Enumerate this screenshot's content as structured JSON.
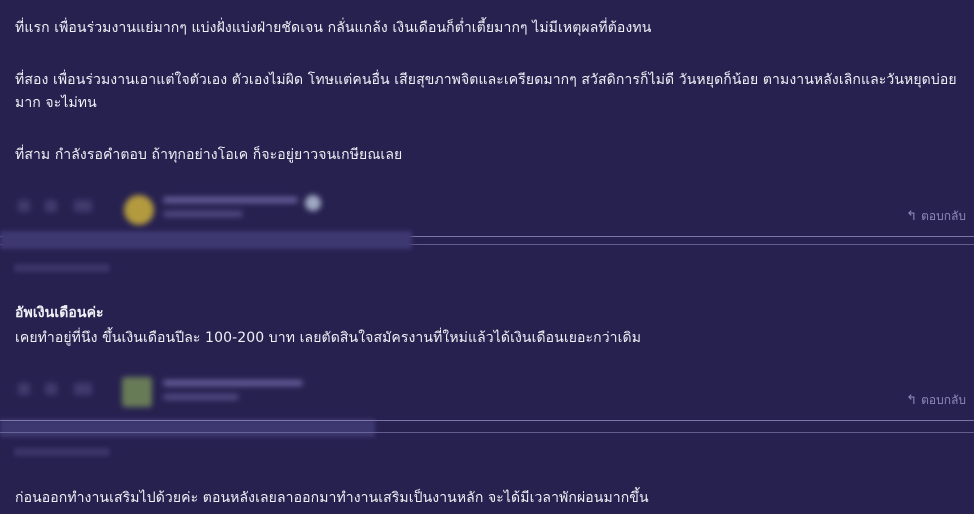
{
  "comments": [
    {
      "paragraphs": [
        "ที่แรก เพื่อนร่วมงานแย่มากๆ แบ่งฝั่งแบ่งฝ่ายชัดเจน กลั่นแกล้ง เงินเดือนก็ต่ำเตี้ยมากๆ ไม่มีเหตุผลที่ต้องทน",
        "ที่สอง เพื่อนร่วมงานเอาแต่ใจตัวเอง ตัวเองไม่ผิด โทษแต่คนอื่น เสียสุขภาพจิตและเครียดมากๆ สวัสดิการก็ไม่ดี วันหยุดก็น้อย ตามงานหลังเลิกและวันหยุดบ่อยมาก จะไม่ทน",
        "ที่สาม กำลังรอคำตอบ ถ้าทุกอย่างโอเค ก็จะอยู่ยาวจนเกษียณเลย"
      ],
      "reply_label": "ตอบกลับ"
    },
    {
      "title": "อัพเงินเดือนค่ะ",
      "body": "เคยทำอยู่ที่นึง ขึ้นเงินเดือนปีละ 100-200 บาท เลยตัดสินใจสมัครงานที่ใหม่แล้วได้เงินเดือนเยอะกว่าเดิม",
      "reply_label": "ตอบกลับ"
    },
    {
      "body": "ก่อนออกทำงานเสริมไปด้วยค่ะ ตอนหลังเลยลาออกมาทำงานเสริมเป็นงานหลัก จะได้มีเวลาพักผ่อนมากขึ้น"
    }
  ],
  "colors": {
    "background": "#272150",
    "text": "#f0f0f6",
    "muted": "#8d87b8",
    "divider": "#7c77aa"
  },
  "icons": {
    "reply": "reply-arrow-icon"
  }
}
